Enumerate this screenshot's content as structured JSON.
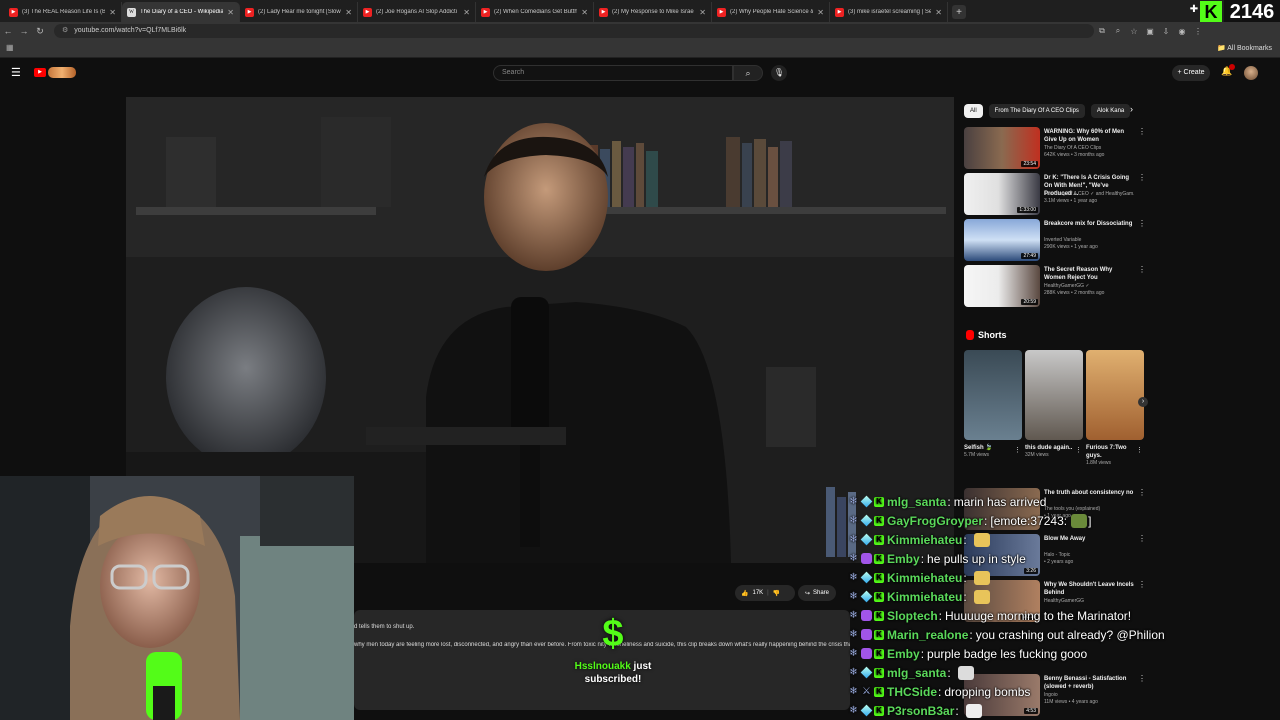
{
  "browser": {
    "tabs": [
      {
        "title": "(3) The REAL Reason Life Is (Br",
        "icon": "youtube-favicon",
        "active": false
      },
      {
        "title": "The Diary of a CEO - Wikipedia",
        "icon": "wikipedia-favicon",
        "active": true
      },
      {
        "title": "(2) Lady Hear me tonight [Slow",
        "icon": "youtube-favicon",
        "active": false
      },
      {
        "title": "(2) Joe Rogans AI Slop Addicti",
        "icon": "youtube-favicon",
        "active": false
      },
      {
        "title": "(2) When Comedians Get Butth",
        "icon": "youtube-favicon",
        "active": false
      },
      {
        "title": "(2) My Response to Mike Israe",
        "icon": "youtube-favicon",
        "active": false
      },
      {
        "title": "(2) Why People Hate Science &",
        "icon": "youtube-favicon",
        "active": false
      },
      {
        "title": "(3) mike israetel screaming | Se",
        "icon": "youtube-favicon",
        "active": false
      }
    ],
    "new_tab": "+",
    "url": "youtube.com/watch?v=QLf7MLBi6lk",
    "all_bookmarks": "All Bookmarks"
  },
  "overlay": {
    "viewer_count": "2146",
    "kick_logo": "K"
  },
  "youtube": {
    "search_placeholder": "Search",
    "create_label": "Create",
    "chips": [
      "All",
      "From The Diary Of A CEO Clips",
      "Alok Kana"
    ],
    "recommendations": [
      {
        "title": "WARNING: Why 60% of Men Give Up on Women",
        "channel": "The Diary Of A CEO Clips",
        "meta": "642K views • 3 months ago",
        "duration": "23:54"
      },
      {
        "title": "Dr K: \"There Is A Crisis Going On With Men!\", \"We've Produced ...",
        "channel": "The Diary Of A CEO ✓ and HealthyGam...",
        "meta": "3.1M views • 1 year ago",
        "duration": "1:33:00"
      },
      {
        "title": "Breakcore mix for Dissociating",
        "channel": "Inverted Variable",
        "meta": "290K views • 1 year ago",
        "duration": "27:49"
      },
      {
        "title": "The Secret Reason Why Women Reject You",
        "channel": "HealthyGamerGG ✓",
        "meta": "288K views • 2 months ago",
        "duration": "20:59"
      }
    ],
    "shorts_header": "Shorts",
    "shorts": [
      {
        "title": "Selfish 🍃",
        "views": "5.7M views"
      },
      {
        "title": "this dude again..",
        "views": "32M views"
      },
      {
        "title": "Furious 7:Two guys.",
        "views": "1.8M views"
      }
    ],
    "recommendations_2": [
      {
        "title": "The truth about consistency no",
        "channel": "The tools you (explained)",
        "meta": "• 1 year ago",
        "duration": ""
      },
      {
        "title": "Blow Me Away",
        "channel": "Halo - Topic",
        "meta": "• 2 years ago",
        "duration": "3:26"
      },
      {
        "title": "Why We Shouldn't Leave Incels Behind",
        "channel": "HealthyGamerGG",
        "meta": "",
        "duration": "20:18"
      },
      {
        "title": "Benny Benassi - Satisfaction (slowed + reverb)",
        "channel": "Ingoio",
        "meta": "11M views • 4 years ago",
        "duration": "4:53"
      }
    ],
    "likes": "17K",
    "share_label": "Share",
    "description_line1": "d tells them to shut up.",
    "description_line2": "why men today are feeling more lost, disconnected, and angry than ever before. From toxic        nity to loneliness and suicide, this clip breaks down what's really happening behind the crisis that so few are talking"
  },
  "sub_alert": {
    "icon": "$",
    "username": "Hsslnouakk",
    "text_suffix": " just",
    "text_line2": "subscribed!"
  },
  "chat": [
    {
      "user": "mlg_santa",
      "color": "#5bd95b",
      "text": "marin has arrived",
      "badge": "sub"
    },
    {
      "user": "GayFrogGroyper",
      "color": "#5bd95b",
      "text": "[emote:37243:",
      "text_after": "]",
      "badge": "sub",
      "emote": "frog"
    },
    {
      "user": "Kimmiehateu",
      "color": "#5bd95b",
      "text": "",
      "badge": "sub",
      "emote": "wave"
    },
    {
      "user": "Emby",
      "color": "#5bd95b",
      "text": "he pulls up in style",
      "badge": "purple"
    },
    {
      "user": "Kimmiehateu",
      "color": "#5bd95b",
      "text": "",
      "badge": "sub",
      "emote": "wave"
    },
    {
      "user": "Kimmiehateu",
      "color": "#5bd95b",
      "text": "",
      "badge": "sub",
      "emote": "wave"
    },
    {
      "user": "Sloptech",
      "color": "#5bd95b",
      "text": "Huuuuge morning to the Marinator!",
      "badge": "purple"
    },
    {
      "user": "Marin_realone",
      "color": "#5bd95b",
      "text": "you crashing out already? @Philion",
      "badge": "purple"
    },
    {
      "user": "Emby",
      "color": "#5bd95b",
      "text": "purple badge les fucking gooo",
      "badge": "purple"
    },
    {
      "user": "mlg_santa",
      "color": "#5bd95b",
      "text": "",
      "badge": "sub",
      "emote": "skull"
    },
    {
      "user": "THCSide",
      "color": "#5bd95b",
      "text": "dropping bombs",
      "badge": "sword"
    },
    {
      "user": "P3rsonB3ar",
      "color": "#5bd95b",
      "text": "",
      "badge": "sub",
      "emote": "hand"
    }
  ],
  "colors": {
    "kick_green": "#53fc18",
    "youtube_red": "#ff0000",
    "bg": "#0f0f0f"
  }
}
